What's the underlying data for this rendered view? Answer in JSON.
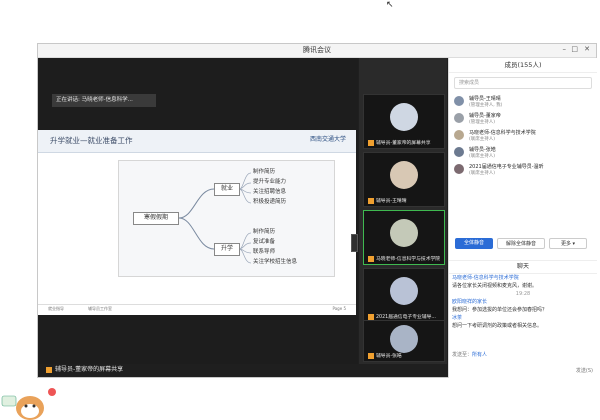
{
  "window": {
    "title": "腾讯会议",
    "controls": [
      "–",
      "□",
      "✕"
    ]
  },
  "stage": {
    "speaker": "正在讲话: 马晓老师-信息科学...",
    "bottom_label": "辅导员-董家帝的屏幕共享"
  },
  "slide": {
    "title": "升学就业—就业准备工作",
    "logo": "西南交通大学",
    "center": "寒假假期",
    "branch1": "就业",
    "branch2": "升学",
    "branch1_items": [
      "制作简历",
      "提升专业能力",
      "关注招聘信息",
      "积极投递简历"
    ],
    "branch2_items": [
      "制作简历",
      "复试准备",
      "联系导师",
      "关注学校招生信息"
    ],
    "footer_left": "就业指导",
    "footer_mid": "辅导员工作室",
    "page": "Page 5"
  },
  "participants_strip": [
    {
      "name": "辅导员-董家帝的屏幕共享"
    },
    {
      "name": "辅导员-王晴晴"
    },
    {
      "name": "马晓老师-信息科学与技术学院"
    },
    {
      "name": "2021届通信电子专业辅导..."
    },
    {
      "name": "辅导员-张皓"
    }
  ],
  "members": {
    "header": "成员(155人)",
    "search_placeholder": "搜索成员",
    "list": [
      {
        "name": "辅导员-王晴晴",
        "role": "(管理主持人, 我)"
      },
      {
        "name": "辅导员-董家帝",
        "role": "(管理主持人)"
      },
      {
        "name": "马晓老师-信息科学与技术学院",
        "role": "(联席主持人)"
      },
      {
        "name": "辅导员-张皓",
        "role": "(联席主持人)"
      },
      {
        "name": "2021届通信电子专业辅导员-温昕",
        "role": "(联席主持人)"
      }
    ],
    "btn_mute": "全体静音",
    "btn_unmute": "解除全体静音",
    "btn_more": "更多 ▾"
  },
  "chat": {
    "header": "聊天",
    "messages": [
      {
        "who": "马晓老师-信息科学与技术学院",
        "text": "请各位家长关闭视频和麦克风，谢谢。"
      },
      {
        "time": "19:28"
      },
      {
        "who": "欧阳晓祥的家长",
        "text": "我想问：参加选拔的单位还会参加春招吗？"
      },
      {
        "who": "冰茶",
        "text": "想问一下考研调剂的政策或者相关信息。"
      }
    ],
    "send_to_label": "发送至：",
    "send_to_value": "所有人",
    "send_btn": "发送(S)"
  },
  "colors": {
    "accent": "#2b6cd6",
    "active_tile": "#3fb950",
    "badge": "#f0a030"
  }
}
